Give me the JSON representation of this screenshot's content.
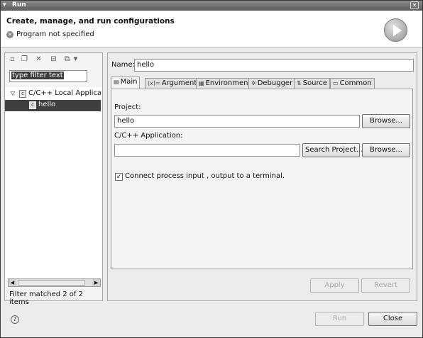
{
  "window": {
    "title": "Run",
    "menu_icon": "chevron-down-icon",
    "btn_icon": "close-icon"
  },
  "header": {
    "title": "Create, manage, and run configurations",
    "status": "Program not specified",
    "status_icon": "error-icon",
    "run_icon": "run-icon"
  },
  "left": {
    "toolbar_icons": [
      "new-config-icon",
      "duplicate-icon",
      "delete-icon",
      "collapse-all-icon",
      "filter-icon"
    ],
    "filter_text": "type filter text",
    "tree": [
      {
        "label": "C/C++ Local Applicatic",
        "badge": "c",
        "expanded": true
      },
      {
        "label": "hello",
        "badge": "c",
        "selected": true
      }
    ],
    "filter_status": "Filter matched 2 of 2 items"
  },
  "right": {
    "name_label": "Name:",
    "name_value": "hello",
    "tabs": [
      {
        "label": "Main",
        "icon": "main-tab-icon",
        "active": true
      },
      {
        "label": "Arguments",
        "icon": "arguments-tab-icon"
      },
      {
        "label": "Environment",
        "icon": "environment-tab-icon"
      },
      {
        "label": "Debugger",
        "icon": "debugger-tab-icon"
      },
      {
        "label": "Source",
        "icon": "source-tab-icon"
      },
      {
        "label": "Common",
        "icon": "common-tab-icon"
      }
    ],
    "main": {
      "project_label": "Project:",
      "project_value": "hello",
      "browse_label": "Browse...",
      "app_label": "C/C++ Application:",
      "app_value": "",
      "search_project_label": "Search Project...",
      "browse2_label": "Browse...",
      "connect_label": "Connect process input , output to a terminal.",
      "connect_checked": true
    },
    "apply_label": "Apply",
    "revert_label": "Revert"
  },
  "footer": {
    "help_icon": "help-icon",
    "run_label": "Run",
    "close_label": "Close"
  }
}
